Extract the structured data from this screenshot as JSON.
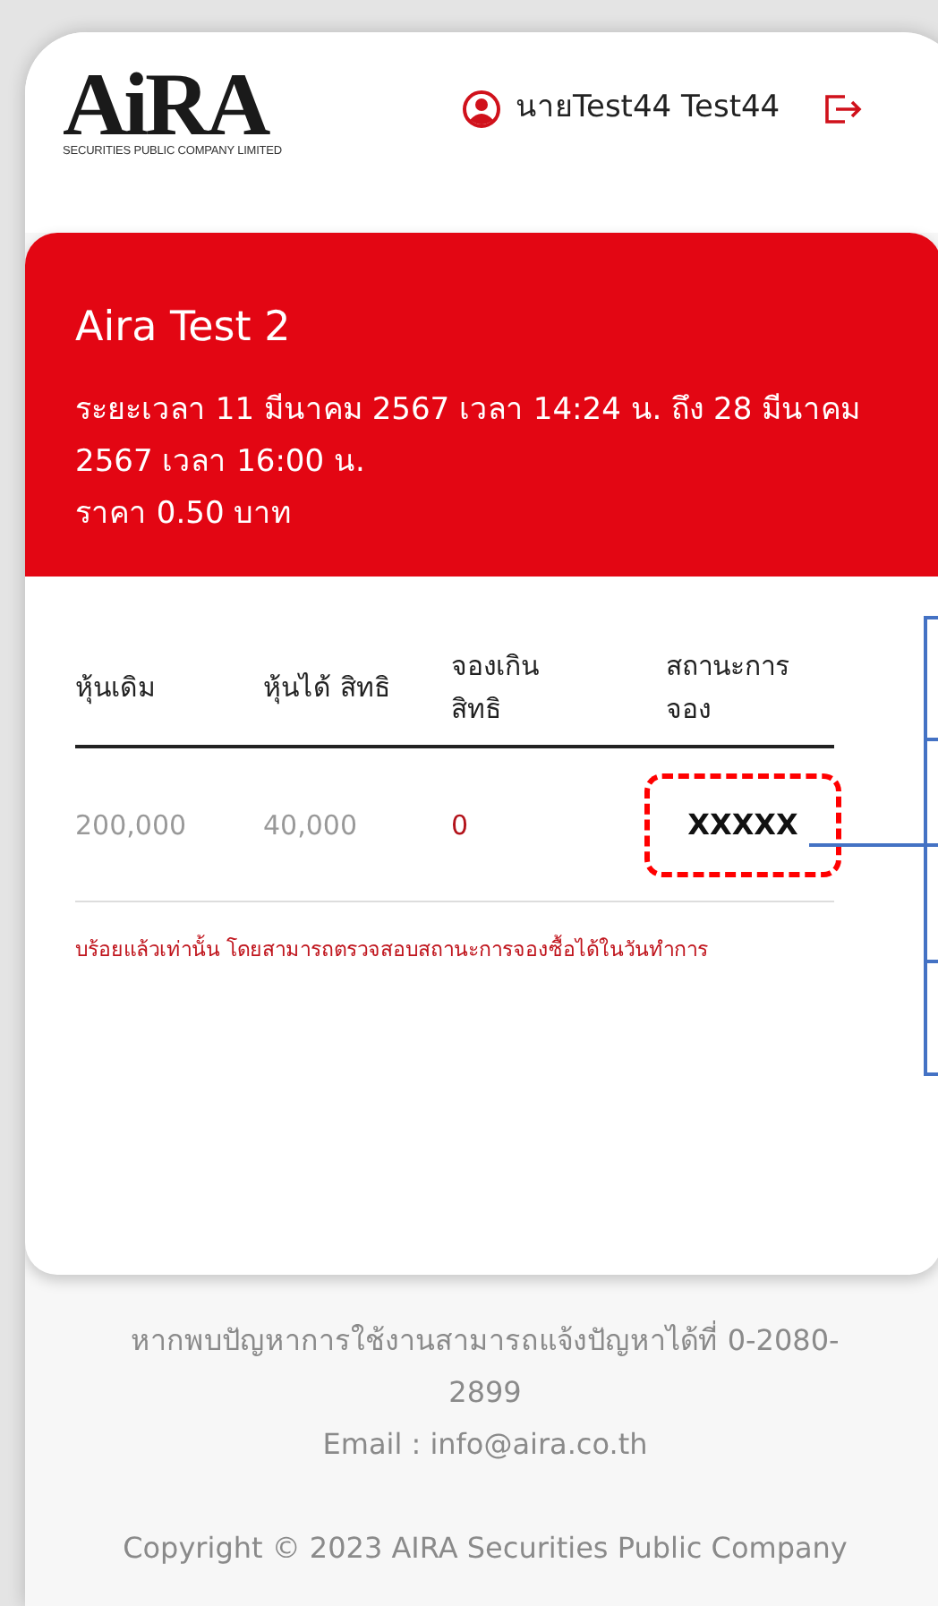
{
  "header": {
    "logo": {
      "wordmark": "AiRA",
      "tagline": "SECURITIES PUBLIC COMPANY LIMITED"
    },
    "user_name": "นายTest44  Test44"
  },
  "offer": {
    "title": "Aira Test 2",
    "period": "ระยะเวลา 11 มีนาคม 2567 เวลา 14:24 น. ถึง 28 มีนาคม 2567 เวลา 16:00 น.",
    "price": "ราคา 0.50 บาท"
  },
  "table": {
    "columns": [
      {
        "label": "หุ้นเดิม"
      },
      {
        "label": "หุ้นได้ สิทธิ"
      },
      {
        "label": "จองเกิน สิทธิ"
      },
      {
        "label": "สถานะการ จอง"
      }
    ],
    "rows": [
      {
        "cells": [
          "200,000",
          "40,000",
          "0",
          "XXXXX"
        ]
      }
    ]
  },
  "notice": "บร้อยแล้วเท่านั้น โดยสามารถตรวจสอบสถานะการจองซื้อได้ในวันทำการ",
  "footer": {
    "contact": "หากพบปัญหาการใช้งานสามารถแจ้งปัญหาได้ที่ 0-2080-2899",
    "email": "Email : info@aira.co.th",
    "copyright": "Copyright © 2023 AIRA Securities Public Company"
  }
}
